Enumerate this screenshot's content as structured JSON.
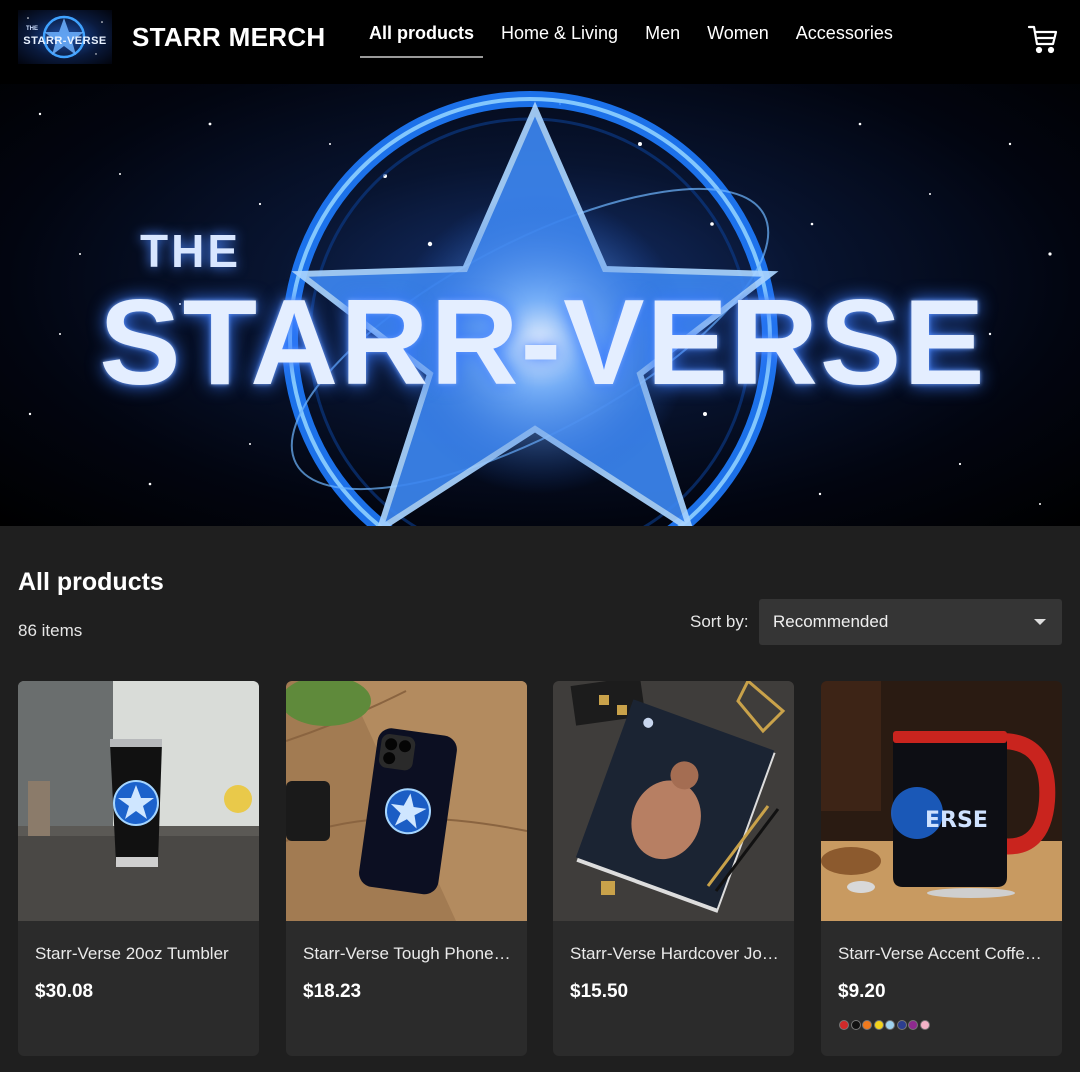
{
  "header": {
    "logo_small_text": "STARR-VERSE",
    "logo_the": "THE",
    "brand": "STARR MERCH",
    "nav": [
      {
        "label": "All products",
        "active": true
      },
      {
        "label": "Home & Living",
        "active": false
      },
      {
        "label": "Men",
        "active": false
      },
      {
        "label": "Women",
        "active": false
      },
      {
        "label": "Accessories",
        "active": false
      }
    ],
    "cart_icon": "cart-icon"
  },
  "hero": {
    "the": "THE",
    "title": "STARR-VERSE"
  },
  "products_section": {
    "title": "All products",
    "count": "86 items",
    "sort_label": "Sort by:",
    "sort_value": "Recommended"
  },
  "products": [
    {
      "name": "Starr-Verse 20oz Tumbler",
      "price": "$30.08"
    },
    {
      "name": "Starr-Verse Tough Phone Case",
      "price": "$18.23"
    },
    {
      "name": "Starr-Verse Hardcover Journal",
      "price": "$15.50"
    },
    {
      "name": "Starr-Verse Accent Coffee Mug",
      "price": "$9.20",
      "colors": [
        "#d12a2a",
        "#111111",
        "#f07a1e",
        "#f3d21c",
        "#9fd3f0",
        "#2c3e8f",
        "#8e2a8f",
        "#f2b3c7"
      ]
    }
  ]
}
